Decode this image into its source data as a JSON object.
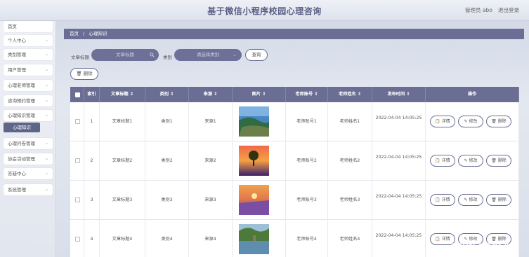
{
  "header": {
    "title": "基于微信小程序校园心理咨询",
    "user": "管理员 abo",
    "logout": "退出登录"
  },
  "sidebar": {
    "items": [
      {
        "label": "首页",
        "has_chevron": false
      },
      {
        "label": "个人中心",
        "has_chevron": true
      },
      {
        "label": "类别管理",
        "has_chevron": true
      },
      {
        "label": "用户管理",
        "has_chevron": true
      },
      {
        "label": "心理老师管理",
        "has_chevron": true
      },
      {
        "label": "咨询预约管理",
        "has_chevron": true
      },
      {
        "label": "心理知识管理",
        "has_chevron": true
      },
      {
        "label": "心理问卷管理",
        "has_chevron": true
      },
      {
        "label": "协会活动管理",
        "has_chevron": true
      },
      {
        "label": "答疑中心",
        "has_chevron": true
      },
      {
        "label": "系统管理",
        "has_chevron": true
      }
    ],
    "submenu": "心理知识"
  },
  "breadcrumb": {
    "home": "首页",
    "sep": "/",
    "current": "心理知识"
  },
  "filters": {
    "title_label": "文章标题",
    "title_placeholder": "文章标题",
    "category_label": "类别",
    "category_placeholder": "请选择类别",
    "search_button": "查询",
    "delete_button": "删除"
  },
  "table": {
    "columns": [
      "索引",
      "文章标题 ⇕",
      "类别 ⇕",
      "来源 ⇕",
      "图片 ⇕",
      "老师账号 ⇕",
      "老师姓名 ⇕",
      "发布时间 ⇕",
      "操作"
    ],
    "rows": [
      {
        "index": "1",
        "title": "文章标题1",
        "category": "类别1",
        "source": "来源1",
        "image": "coast",
        "teacher_account": "老师账号1",
        "teacher_name": "老师姓名1",
        "time": "2022-04-04 14:05:25"
      },
      {
        "index": "2",
        "title": "文章标题2",
        "category": "类别2",
        "source": "来源2",
        "image": "sunset-tree",
        "teacher_account": "老师账号2",
        "teacher_name": "老师姓名2",
        "time": "2022-04-04 14:05:25"
      },
      {
        "index": "3",
        "title": "文章标题3",
        "category": "类别3",
        "source": "来源3",
        "image": "lavender",
        "teacher_account": "老师账号3",
        "teacher_name": "老师姓名3",
        "time": "2022-04-04 14:05:25"
      },
      {
        "index": "4",
        "title": "文章标题4",
        "category": "类别4",
        "source": "来源4",
        "image": "lake",
        "teacher_account": "老师账号4",
        "teacher_name": "老师姓名4",
        "time": "2022-04-04 14:05:25"
      }
    ],
    "actions": {
      "detail": "详情",
      "edit": "修改",
      "delete": "删除"
    }
  },
  "watermark": "CSDN @毕设 小健",
  "colors": {
    "accent": "#6a6d94",
    "header_text": "#5a5e84"
  }
}
